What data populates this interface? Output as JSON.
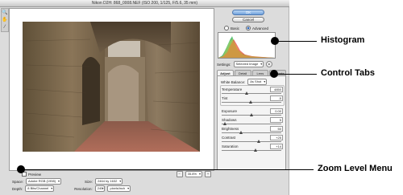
{
  "window": {
    "title": "Nikon D2H: 868_0008.NEF (ISO 200, 1/125, F/5.6, 35 mm)"
  },
  "toolbar": {
    "tools": [
      {
        "icon": "zoom-tool-icon",
        "glyph": "🔍"
      },
      {
        "icon": "hand-tool-icon",
        "glyph": "✋"
      },
      {
        "icon": "eyedropper-tool-icon",
        "glyph": "⁄"
      }
    ]
  },
  "preview": {
    "checkbox_label": "Preview",
    "zoom_level": "35.8%",
    "zoom_in_label": "+",
    "zoom_out_label": "−"
  },
  "workflow": {
    "space_label": "Space:",
    "space_value": "Adobe RGB (1998)",
    "size_label": "Size:",
    "size_value": "2464 by 1632",
    "depth_label": "Depth:",
    "depth_value": "8 Bits/Channel",
    "resolution_label": "Resolution:",
    "resolution_value": "240",
    "resolution_unit": "pixels/inch"
  },
  "actions": {
    "ok_label": "OK",
    "cancel_label": "Cancel"
  },
  "mode": {
    "basic_label": "Basic",
    "advanced_label": "Advanced",
    "selected": "Advanced"
  },
  "settings": {
    "label": "Settings:",
    "value": "Selected Image"
  },
  "tabs": [
    {
      "label": "Adjust",
      "active": true
    },
    {
      "label": "Detail",
      "active": false
    },
    {
      "label": "Lens",
      "active": false
    },
    {
      "label": "Calibrate",
      "active": false
    }
  ],
  "white_balance": {
    "label": "White Balance:",
    "value": "As Shot"
  },
  "sliders": [
    {
      "name": "temperature",
      "label": "Temperature",
      "value": "4850",
      "fraction": 0.42
    },
    {
      "name": "tint",
      "label": "Tint",
      "value": "-5",
      "fraction": 0.48
    },
    {
      "name": "exposure",
      "label": "Exposure",
      "value": "0.00",
      "fraction": 0.5
    },
    {
      "name": "shadows",
      "label": "Shadows",
      "value": "5",
      "fraction": 0.05
    },
    {
      "name": "brightness",
      "label": "Brightness",
      "value": "50",
      "fraction": 0.33
    },
    {
      "name": "contrast",
      "label": "Contrast",
      "value": "+25",
      "fraction": 0.62
    },
    {
      "name": "saturation",
      "label": "Saturation",
      "value": "+14",
      "fraction": 0.57
    }
  ],
  "callouts": {
    "histogram": "Histogram",
    "control_tabs": "Control Tabs",
    "zoom_level_menu": "Zoom Level Menu"
  },
  "colors": {
    "callout": "#000000",
    "accent": "#4c79b3",
    "panel": "#dcdcdc"
  }
}
